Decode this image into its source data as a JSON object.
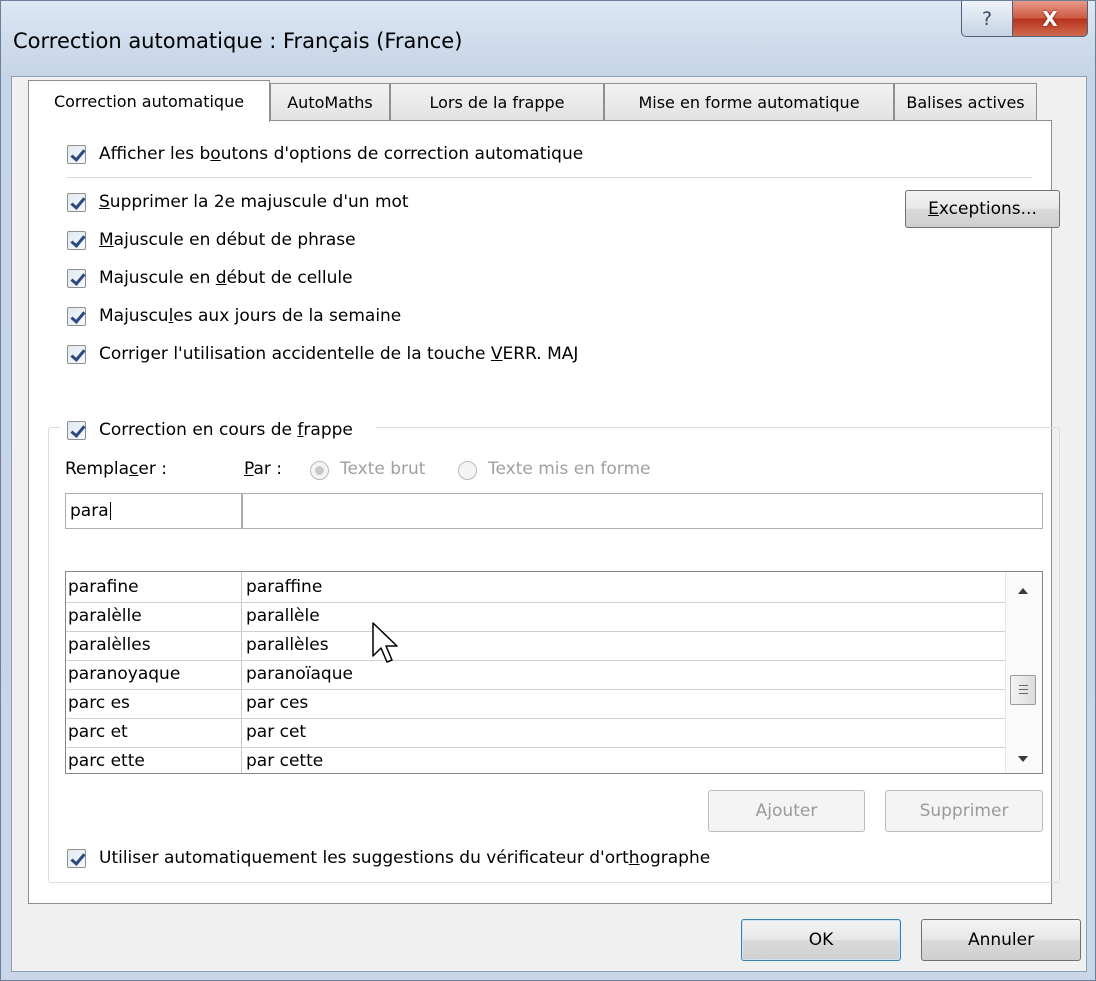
{
  "window": {
    "title": "Correction automatique : Français (France)",
    "help_glyph": "?",
    "close_glyph": "X"
  },
  "tabs": [
    {
      "label": "Correction automatique",
      "active": true
    },
    {
      "label": "AutoMaths"
    },
    {
      "label": "Lors de la frappe"
    },
    {
      "label": "Mise en forme automatique"
    },
    {
      "label": "Balises actives"
    }
  ],
  "options": {
    "show_buttons": {
      "pre": "Afficher les b",
      "u": "o",
      "post": "utons d'options de correction automatique",
      "checked": true
    },
    "two_caps": {
      "pre": "",
      "u": "S",
      "post": "upprimer la 2e majuscule d'un mot",
      "checked": true
    },
    "sentence_cap": {
      "pre": "",
      "u": "M",
      "post": "ajuscule en début de phrase",
      "checked": true
    },
    "cell_cap": {
      "pre": "Majuscule en ",
      "u": "d",
      "post": "ébut de cellule",
      "checked": true
    },
    "days_cap": {
      "pre": "Majuscu",
      "u": "l",
      "post": "es aux jours de la semaine",
      "checked": true
    },
    "caps_lock": {
      "pre": "Corriger l'utilisation accidentelle de la touche ",
      "u": "V",
      "post": "ERR. MAJ",
      "checked": true
    }
  },
  "exceptions_button": {
    "u": "E",
    "post": "xceptions..."
  },
  "replace_group": {
    "toggle": {
      "pre": "Correction en cours de ",
      "u": "f",
      "post": "rappe",
      "checked": true
    },
    "replace_label": {
      "pre": "Rempla",
      "u": "c",
      "post": "er :"
    },
    "with_label": {
      "pre": "",
      "u": "P",
      "post": "ar :"
    },
    "radio_plain": "Texte brut",
    "radio_formatted": "Texte mis en forme",
    "replace_value": "para",
    "with_value": "",
    "entries": [
      {
        "from": "parafine",
        "to": "paraffine"
      },
      {
        "from": "paralèlle",
        "to": "parallèle"
      },
      {
        "from": "paralèlles",
        "to": "parallèles"
      },
      {
        "from": "paranoyaque",
        "to": "paranoïaque"
      },
      {
        "from": "parc es",
        "to": "par ces"
      },
      {
        "from": "parc et",
        "to": "par cet"
      },
      {
        "from": "parc ette",
        "to": "par cette"
      }
    ],
    "add_button": "Ajouter",
    "delete_button": "Supprimer",
    "spell_suggest": {
      "pre": "Utiliser automatiquement les suggestions du vérificateur d'ort",
      "u": "h",
      "post": "ographe",
      "checked": true
    }
  },
  "footer": {
    "ok": "OK",
    "cancel": "Annuler"
  }
}
